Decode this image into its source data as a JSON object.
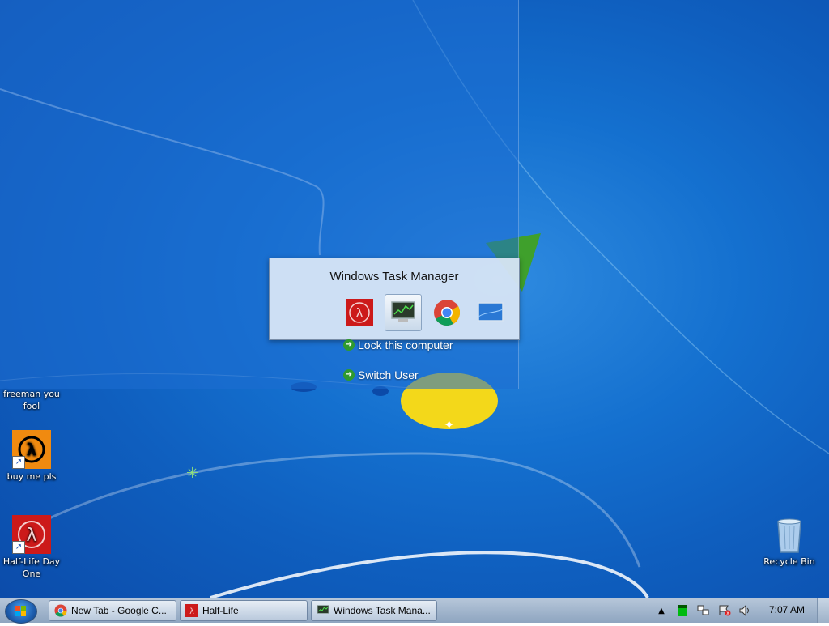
{
  "desktop": {
    "icons": [
      {
        "label": "freeman you fool"
      },
      {
        "label": "buy me pls"
      },
      {
        "label": "Half-Life Day One"
      },
      {
        "label": "Recycle Bin"
      }
    ]
  },
  "alt_tab": {
    "title": "Windows Task Manager",
    "apps": [
      {
        "name": "half-life-icon"
      },
      {
        "name": "task-manager-icon"
      },
      {
        "name": "chrome-icon"
      },
      {
        "name": "desktop-icon"
      }
    ]
  },
  "security_options": {
    "lock": "Lock this computer",
    "switch_user": "Switch User"
  },
  "taskbar": {
    "buttons": [
      {
        "label": "New Tab - Google C...",
        "icon": "chrome-icon"
      },
      {
        "label": "Half-Life",
        "icon": "half-life-icon"
      },
      {
        "label": "Windows Task Mana...",
        "icon": "task-manager-icon"
      }
    ],
    "clock": "7:07 AM"
  },
  "colors": {
    "accent": "#1470cf",
    "halflife_red": "#cc1a1a",
    "halflife_orange": "#f08a10"
  }
}
